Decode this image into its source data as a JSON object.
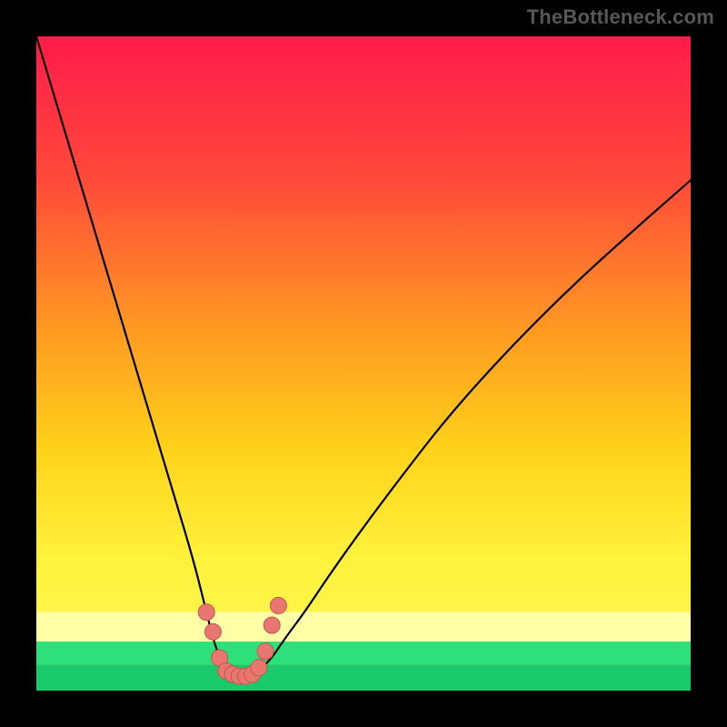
{
  "watermark": "TheBottleneck.com",
  "colors": {
    "frame": "#000000",
    "watermark_text": "#575757",
    "curve_stroke": "#000000",
    "marker_fill": "#e8776f",
    "marker_stroke": "#c2574f",
    "gradient": {
      "top": "#ff1a4a",
      "mid_upper": "#ff6a2d",
      "mid": "#ffd21a",
      "mid_lower": "#fff24a",
      "band_pale": "#ffffa8",
      "green": "#2de07a",
      "green_deep": "#19c96a"
    }
  },
  "chart_data": {
    "type": "line",
    "title": "",
    "xlabel": "",
    "ylabel": "",
    "xlim": [
      0,
      100
    ],
    "ylim": [
      0,
      100
    ],
    "series": [
      {
        "name": "left-curve",
        "x": [
          0,
          3,
          6,
          9,
          12,
          15,
          18,
          21,
          24,
          26,
          27,
          28,
          29,
          30
        ],
        "y": [
          100,
          90,
          80,
          70,
          60,
          50,
          40,
          30,
          20,
          12,
          8,
          5,
          3,
          2
        ]
      },
      {
        "name": "right-curve",
        "x": [
          33,
          34,
          36,
          38,
          41,
          45,
          50,
          56,
          63,
          72,
          82,
          92,
          100
        ],
        "y": [
          2,
          3,
          5,
          8,
          12,
          18,
          25,
          33,
          42,
          52,
          62,
          71,
          78
        ]
      }
    ],
    "bottom_bands": [
      {
        "name": "pale-yellow-band",
        "y_from": 12.0,
        "y_to": 7.5,
        "color": "#ffffa8"
      },
      {
        "name": "green-band",
        "y_from": 7.5,
        "y_to": 4.0,
        "color": "#2de07a"
      }
    ],
    "markers": {
      "name": "valley-markers",
      "points": [
        {
          "x": 26,
          "y": 12
        },
        {
          "x": 27,
          "y": 9
        },
        {
          "x": 28,
          "y": 5
        },
        {
          "x": 29,
          "y": 3
        },
        {
          "x": 30,
          "y": 2.5
        },
        {
          "x": 31,
          "y": 2.2
        },
        {
          "x": 32,
          "y": 2.2
        },
        {
          "x": 33,
          "y": 2.5
        },
        {
          "x": 34,
          "y": 3.5
        },
        {
          "x": 35,
          "y": 6
        },
        {
          "x": 36,
          "y": 10
        },
        {
          "x": 37,
          "y": 13
        }
      ]
    }
  }
}
